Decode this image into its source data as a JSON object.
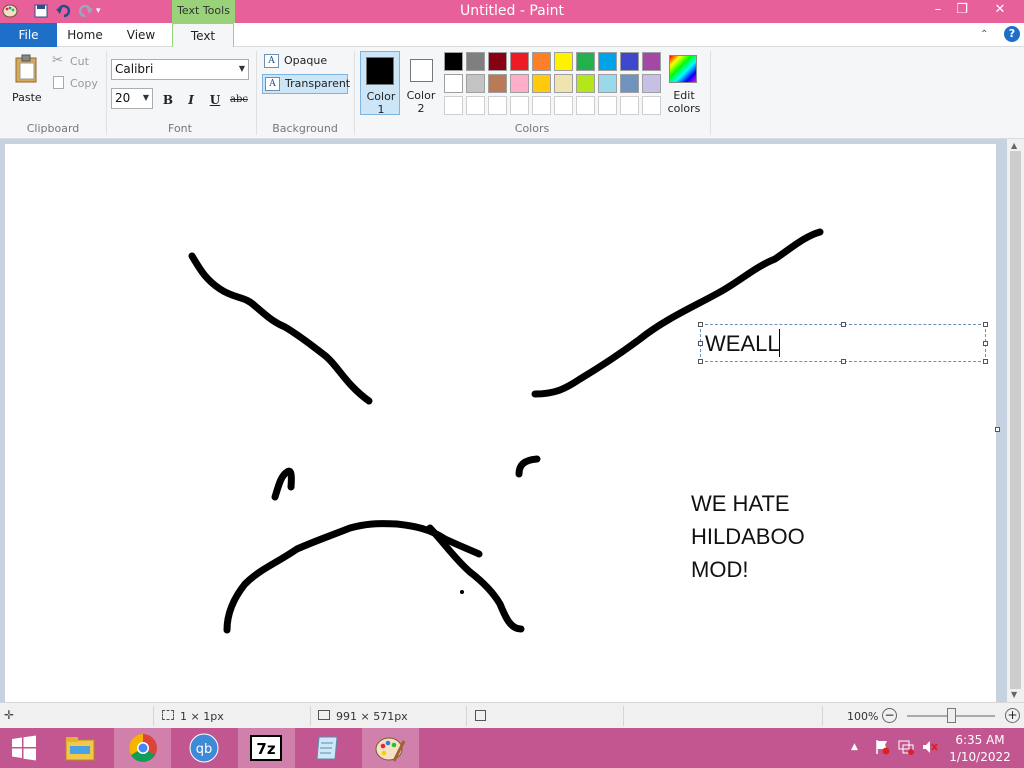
{
  "window": {
    "title": "Untitled - Paint",
    "context_tab": "Text Tools",
    "minimize_glyph": "–",
    "restore_glyph": "❐",
    "close_glyph": "✕"
  },
  "tabs": {
    "file": "File",
    "home": "Home",
    "view": "View",
    "text": "Text"
  },
  "ribbon": {
    "clipboard": {
      "paste": "Paste",
      "cut": "Cut",
      "copy": "Copy",
      "label": "Clipboard"
    },
    "font": {
      "family": "Calibri",
      "size": "20",
      "bold": "B",
      "italic": "I",
      "underline": "U",
      "strike": "abc",
      "label": "Font"
    },
    "background": {
      "opaque": "Opaque",
      "transparent": "Transparent",
      "label": "Background"
    },
    "colors": {
      "color1": "Color 1",
      "color1_line1": "Color",
      "color1_line2": "1",
      "color2_line1": "Color",
      "color2_line2": "2",
      "edit_line1": "Edit",
      "edit_line2": "colors",
      "label": "Colors",
      "color1_value": "#000000",
      "color2_value": "#ffffff",
      "palette_row1": [
        "#000000",
        "#7f7f7f",
        "#880015",
        "#ed1c24",
        "#ff7f27",
        "#fff200",
        "#22b14c",
        "#00a2e8",
        "#3f48cc",
        "#a349a4"
      ],
      "palette_row2": [
        "#ffffff",
        "#c3c3c3",
        "#b97a57",
        "#ffaec9",
        "#ffc90e",
        "#efe4b0",
        "#b5e61d",
        "#99d9ea",
        "#7092be",
        "#c8bfe7"
      ],
      "palette_row3": [
        "#ffffff",
        "#ffffff",
        "#ffffff",
        "#ffffff",
        "#ffffff",
        "#ffffff",
        "#ffffff",
        "#ffffff",
        "#ffffff",
        "#ffffff"
      ]
    }
  },
  "canvas": {
    "editing_text": "WEALL",
    "text_line1": "WE HATE",
    "text_line2": "HILDABOO",
    "text_line3": "MOD!"
  },
  "status": {
    "selection_size": "1 × 1px",
    "image_size": "991 × 571px",
    "zoom": "100%",
    "zoom_level": 1.0
  },
  "taskbar": {
    "apps": [
      "windows-start",
      "file-explorer",
      "chrome",
      "qbittorrent",
      "7zip",
      "notepad",
      "paint"
    ],
    "time": "6:35 AM",
    "date": "1/10/2022"
  }
}
